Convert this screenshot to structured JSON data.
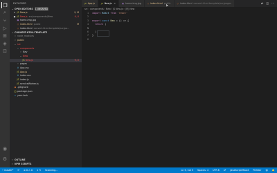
{
  "activity_bar": {
    "icons": [
      {
        "name": "files-icon",
        "glyph": "❐",
        "active": true
      },
      {
        "name": "search-icon",
        "glyph": "⌕",
        "active": false
      },
      {
        "name": "source-control-icon",
        "glyph": "⑂",
        "active": false
      },
      {
        "name": "run-debug-icon",
        "glyph": "▷",
        "active": false
      },
      {
        "name": "extensions-icon",
        "glyph": "⊞",
        "active": false
      },
      {
        "name": "docker-icon",
        "glyph": "◈",
        "active": false
      },
      {
        "name": "remote-icon",
        "glyph": "⊡",
        "active": false
      },
      {
        "name": "accounts-icon",
        "glyph": "◉",
        "active": false
      },
      {
        "name": "gear-icon",
        "glyph": "⚙",
        "active": false
      }
    ]
  },
  "sidebar": {
    "title": "EXPLORER",
    "open_editors": {
      "label": "OPEN EDITORS",
      "badge": "1 UNSAVED",
      "items": [
        {
          "prefix": "×",
          "icon": "JS",
          "icon_color": "#cbcb41",
          "name": "New.js",
          "sub": "",
          "status": "9, M",
          "color": "#e2c08d"
        },
        {
          "prefix": "●",
          "icon": "JS",
          "icon_color": "#cbcb41",
          "name": "New.js",
          "sub": "src/components/New",
          "status": "9, U",
          "color": "#f14c4c"
        },
        {
          "prefix": "",
          "icon": "▣",
          "icon_color": "#a074c4",
          "name": "home-img.jpg",
          "sub": "",
          "status": "",
          "color": "#cccccc"
        },
        {
          "prefix": "",
          "icon": "◇",
          "icon_color": "#e37933",
          "name": "index.html",
          "sub": "public",
          "status": "M",
          "color": "#e2c08d"
        },
        {
          "prefix": "",
          "icon": "◇",
          "icon_color": "#e37933",
          "name": "index.html",
          "sub": "convert-html-template/src/pa...",
          "status": "",
          "color": "#cccccc"
        }
      ]
    },
    "folder": {
      "label": "CONVERT-HTML-TEMPLATE",
      "items": [
        {
          "indent": 1,
          "icon": "›",
          "icon_color": "#cccccc",
          "name": "node_modules",
          "status": "",
          "color": "#8b8b8b"
        },
        {
          "indent": 1,
          "icon": "›",
          "icon_color": "#cccccc",
          "name": "public",
          "status": "",
          "color": "#e2c08d"
        },
        {
          "indent": 1,
          "icon": "⌄",
          "icon_color": "#cccccc",
          "name": "src",
          "status": "",
          "color": "#f14c4c"
        },
        {
          "indent": 2,
          "icon": "⌄",
          "icon_color": "#cccccc",
          "name": "components",
          "status": "",
          "color": "#f14c4c"
        },
        {
          "indent": 3,
          "icon": "›",
          "icon_color": "#cccccc",
          "name": "Nav",
          "status": "",
          "color": "#cccccc"
        },
        {
          "indent": 3,
          "icon": "⌄",
          "icon_color": "#cccccc",
          "name": "New",
          "status": "",
          "color": "#f14c4c"
        },
        {
          "indent": 4,
          "icon": "JS",
          "icon_color": "#cbcb41",
          "name": "New.js",
          "status": "9, U",
          "color": "#f14c4c",
          "selected": true
        },
        {
          "indent": 2,
          "icon": "›",
          "icon_color": "#cccccc",
          "name": "pages",
          "status": "",
          "color": "#cccccc"
        },
        {
          "indent": 2,
          "icon": "#",
          "icon_color": "#519aba",
          "name": "App.css",
          "status": "",
          "color": "#cccccc"
        },
        {
          "indent": 2,
          "icon": "JS",
          "icon_color": "#cbcb41",
          "name": "App.js",
          "status": "",
          "color": "#e2c08d"
        },
        {
          "indent": 2,
          "icon": "#",
          "icon_color": "#519aba",
          "name": "index.css",
          "status": "",
          "color": "#cccccc"
        },
        {
          "indent": 2,
          "icon": "JS",
          "icon_color": "#cbcb41",
          "name": "index.js",
          "status": "",
          "color": "#cccccc"
        },
        {
          "indent": 2,
          "icon": "JS",
          "icon_color": "#cbcb41",
          "name": "serviceWorker.js",
          "status": "",
          "color": "#cccccc"
        },
        {
          "indent": 1,
          "icon": "◆",
          "icon_color": "#e37933",
          "name": ".gitignore",
          "status": "",
          "color": "#cccccc"
        },
        {
          "indent": 1,
          "icon": "{}",
          "icon_color": "#cbcb41",
          "name": "package.json",
          "status": "",
          "color": "#cccccc"
        },
        {
          "indent": 1,
          "icon": "⊙",
          "icon_color": "#2c8ebb",
          "name": "yarn.lock",
          "status": "",
          "color": "#cccccc"
        }
      ]
    },
    "outline_label": "OUTLINE",
    "npm_label": "NPM SCRIPTS"
  },
  "tabs": [
    {
      "icon": "JS",
      "icon_color": "#cbcb41",
      "label": "App.js",
      "sub": "",
      "active": false,
      "color": "#e2c08d"
    },
    {
      "icon": "JS",
      "icon_color": "#cbcb41",
      "label": "New.js",
      "sub": "",
      "active": true,
      "color": "#ffffff",
      "close": "×"
    },
    {
      "icon": "▣",
      "icon_color": "#a074c4",
      "label": "home-img.jpg",
      "sub": "",
      "active": false,
      "color": "#969696"
    },
    {
      "icon": "◇",
      "icon_color": "#e37933",
      "label": "index.html",
      "sub": "public",
      "active": false,
      "color": "#e2c08d"
    },
    {
      "icon": "◇",
      "icon_color": "#e37933",
      "label": "index.html",
      "sub": "convert-html-template/src/pages",
      "active": false,
      "color": "#969696"
    }
  ],
  "tab_actions": [
    "⇄",
    "◫",
    "···"
  ],
  "breadcrumb": [
    "src",
    "›",
    "components",
    "›",
    "New",
    "›",
    "JS New.js",
    "›",
    "[@] New"
  ],
  "code_lines": [
    {
      "num": "1",
      "tokens": [
        {
          "t": "import",
          "c": "kw2"
        },
        {
          "t": " React ",
          "c": "var"
        },
        {
          "t": "from",
          "c": "kw2"
        },
        {
          "t": " 'react'",
          "c": "str"
        }
      ]
    },
    {
      "num": "2",
      "tokens": []
    },
    {
      "num": "3",
      "tokens": [
        {
          "t": "export",
          "c": "kw2"
        },
        {
          "t": " const ",
          "c": "kw"
        },
        {
          "t": "New",
          "c": "fn"
        },
        {
          "t": " = () => {",
          "c": "punc"
        }
      ]
    },
    {
      "num": "4",
      "tokens": [
        {
          "t": "  return",
          "c": "kw2"
        },
        {
          "t": " (",
          "c": "punc"
        }
      ]
    },
    {
      "num": "5",
      "tokens": [],
      "current": true
    },
    {
      "num": "6",
      "tokens": [
        {
          "t": "  )",
          "c": "punc"
        }
      ]
    },
    {
      "num": "7",
      "tokens": [
        {
          "t": "}",
          "c": "punc"
        }
      ]
    },
    {
      "num": "8",
      "tokens": []
    }
  ],
  "status_left": [
    "⑂ master*",
    "⟳",
    "⊗ 0 ⚠ 0",
    "1 ⟲",
    "Scanning..."
  ],
  "status_right": [
    "Ln 5, Col 5",
    "Spaces: 4",
    "UTF-8",
    "LF",
    "JavaScript React",
    "Prettier",
    "☺",
    "🔔"
  ]
}
